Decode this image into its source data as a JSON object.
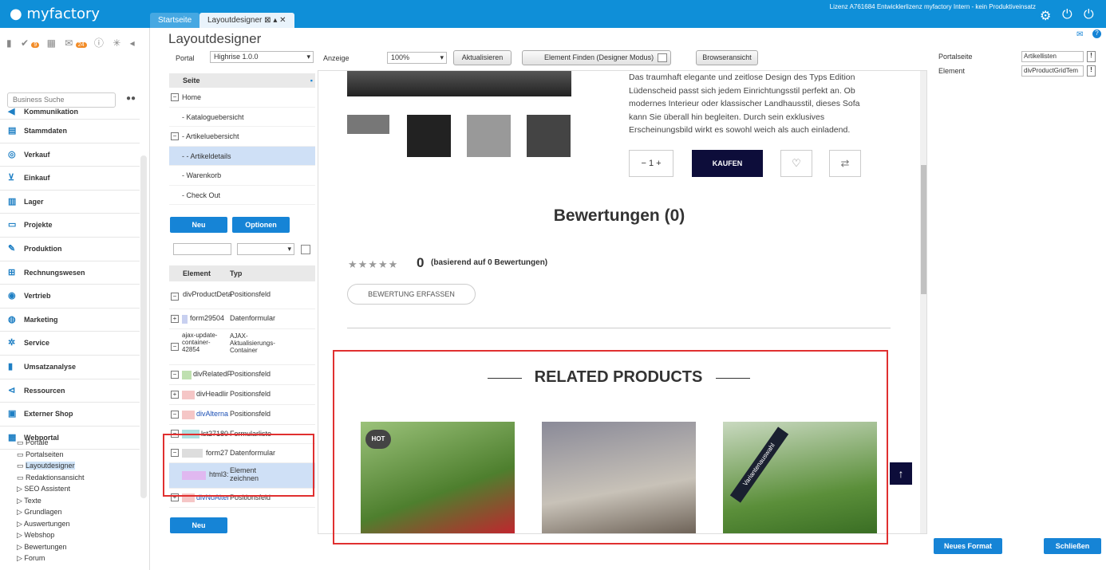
{
  "app": {
    "logo": "myfactory",
    "license": "Lizenz A761684 Entwicklerlizenz myfactory Intern - kein Produktiveinsatz"
  },
  "tabs": [
    {
      "label": "Startseite"
    },
    {
      "label": "Layoutdesigner ⊠ ▴ ✕"
    }
  ],
  "sidebar": {
    "badges": [
      "9",
      "24"
    ],
    "search_placeholder": "Business Suche",
    "items": [
      "Kommunikation",
      "Stammdaten",
      "Verkauf",
      "Einkauf",
      "Lager",
      "Projekte",
      "Produktion",
      "Rechnungswesen",
      "Vertrieb",
      "Marketing",
      "Service",
      "Umsatzanalyse",
      "Ressourcen",
      "Externer Shop",
      "Webportal"
    ],
    "subitems": [
      "Portale",
      "Portalseiten",
      "Layoutdesigner",
      "Redaktionsansicht",
      "SEO Assistent",
      "Texte",
      "Grundlagen",
      "Auswertungen",
      "Webshop",
      "Bewertungen",
      "Forum"
    ]
  },
  "page": {
    "title": "Layoutdesigner"
  },
  "toolbar": {
    "portal_label": "Portal",
    "portal_value": "Highrise 1.0.0",
    "anzeige_label": "Anzeige",
    "zoom_value": "100%",
    "aktualisieren": "Aktualisieren",
    "element_finden": "Element Finden (Designer Modus)",
    "browseransicht": "Browseransicht"
  },
  "tree": {
    "header": "Seite",
    "rows": [
      "Home",
      "- Kataloguebersicht",
      "- Artikeluebersicht",
      "- - Artikeldetails",
      "- Warenkorb",
      "- Check Out"
    ],
    "neu": "Neu",
    "optionen": "Optionen"
  },
  "elements": {
    "col_element": "Element",
    "col_typ": "Typ",
    "rows": [
      {
        "name": "divProductDeta",
        "typ": "Positionsfeld"
      },
      {
        "name": "form29504",
        "typ": "Datenformular"
      },
      {
        "name": "ajax-update-container-42854",
        "typ": "AJAX-Aktualisierungs-Container"
      },
      {
        "name": "divRelatedF",
        "typ": "Positionsfeld"
      },
      {
        "name": "divHeadlir",
        "typ": "Positionsfeld"
      },
      {
        "name": "divAlterna",
        "typ": "Positionsfeld"
      },
      {
        "name": "lst27180",
        "typ": "Formularliste"
      },
      {
        "name": "form27",
        "typ": "Datenformular"
      },
      {
        "name": "html3:",
        "typ": "Element zeichnen"
      },
      {
        "name": "divNoAlter",
        "typ": "Positionsfeld"
      }
    ],
    "neu": "Neu"
  },
  "preview": {
    "desc": "Das traumhaft elegante und zeitlose Design des Typs Edition Lüdenscheid passt sich jedem Einrichtungsstil perfekt an. Ob modernes Interieur oder klassischer Landhausstil, dieses Sofa kann Sie überall hin begleiten. Durch sein exklusives Erscheinungsbild wirkt es sowohl weich als auch einladend.",
    "qty": "1",
    "kaufen": "KAUFEN",
    "bewertungen": "Bewertungen (0)",
    "rating": "0",
    "rating_note": "(basierend auf 0 Bewertungen)",
    "bewertung_btn": "BEWERTUNG ERFASSEN",
    "related": "RELATED PRODUCTS",
    "hot": "HOT",
    "variant": "Variantenauswahl"
  },
  "right": {
    "portalseite_label": "Portalseite",
    "portalseite_value": "Artikellisten",
    "element_label": "Element",
    "element_value": "divProductGridTem",
    "neues_format": "Neues Format",
    "schliessen": "Schließen"
  }
}
